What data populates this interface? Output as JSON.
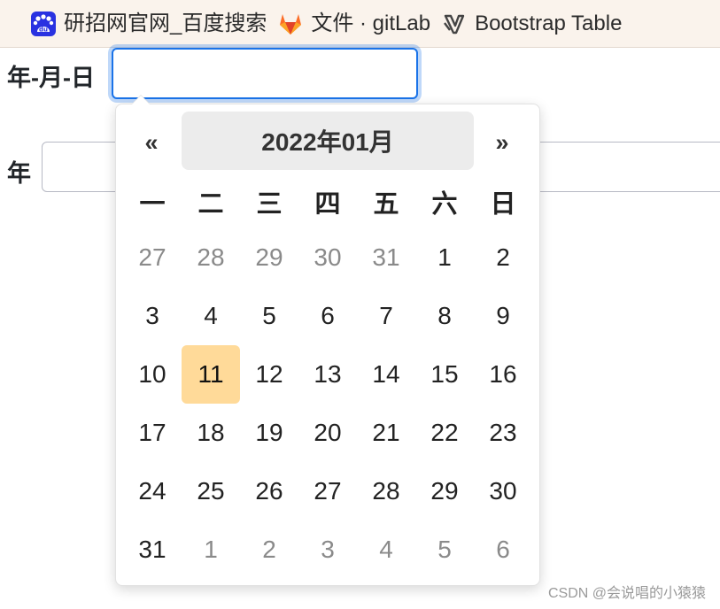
{
  "bookmarks": [
    {
      "label": "研招网官网_百度搜索",
      "icon": "baidu-paw-icon",
      "color": "#2932e1"
    },
    {
      "label": "文件 · gitLab",
      "icon": "gitlab-fox-icon",
      "color": "#fc6d26"
    },
    {
      "label": "Bootstrap Table",
      "icon": "bootstrap-table-icon",
      "color": "#444444"
    }
  ],
  "form": {
    "date_label": "年-月-日",
    "date_value": "",
    "year_label": "年",
    "year_value": ""
  },
  "datepicker": {
    "prev": "«",
    "next": "»",
    "title": "2022年01月",
    "weekdays": [
      "一",
      "二",
      "三",
      "四",
      "五",
      "六",
      "日"
    ],
    "days": [
      {
        "label": "27",
        "muted": true
      },
      {
        "label": "28",
        "muted": true
      },
      {
        "label": "29",
        "muted": true
      },
      {
        "label": "30",
        "muted": true
      },
      {
        "label": "31",
        "muted": true
      },
      {
        "label": "1"
      },
      {
        "label": "2"
      },
      {
        "label": "3"
      },
      {
        "label": "4"
      },
      {
        "label": "5"
      },
      {
        "label": "6"
      },
      {
        "label": "7"
      },
      {
        "label": "8"
      },
      {
        "label": "9"
      },
      {
        "label": "10"
      },
      {
        "label": "11",
        "today": true
      },
      {
        "label": "12"
      },
      {
        "label": "13"
      },
      {
        "label": "14"
      },
      {
        "label": "15"
      },
      {
        "label": "16"
      },
      {
        "label": "17"
      },
      {
        "label": "18"
      },
      {
        "label": "19"
      },
      {
        "label": "20"
      },
      {
        "label": "21"
      },
      {
        "label": "22"
      },
      {
        "label": "23"
      },
      {
        "label": "24"
      },
      {
        "label": "25"
      },
      {
        "label": "26"
      },
      {
        "label": "27"
      },
      {
        "label": "28"
      },
      {
        "label": "29"
      },
      {
        "label": "30"
      },
      {
        "label": "31"
      },
      {
        "label": "1",
        "muted": true
      },
      {
        "label": "2",
        "muted": true
      },
      {
        "label": "3",
        "muted": true
      },
      {
        "label": "4",
        "muted": true
      },
      {
        "label": "5",
        "muted": true
      },
      {
        "label": "6",
        "muted": true
      }
    ],
    "today_color": "#ffda99",
    "title_bg": "#ececec"
  },
  "focus_color": "#1a73e8",
  "watermark": "CSDN @会说唱的小猿猿"
}
